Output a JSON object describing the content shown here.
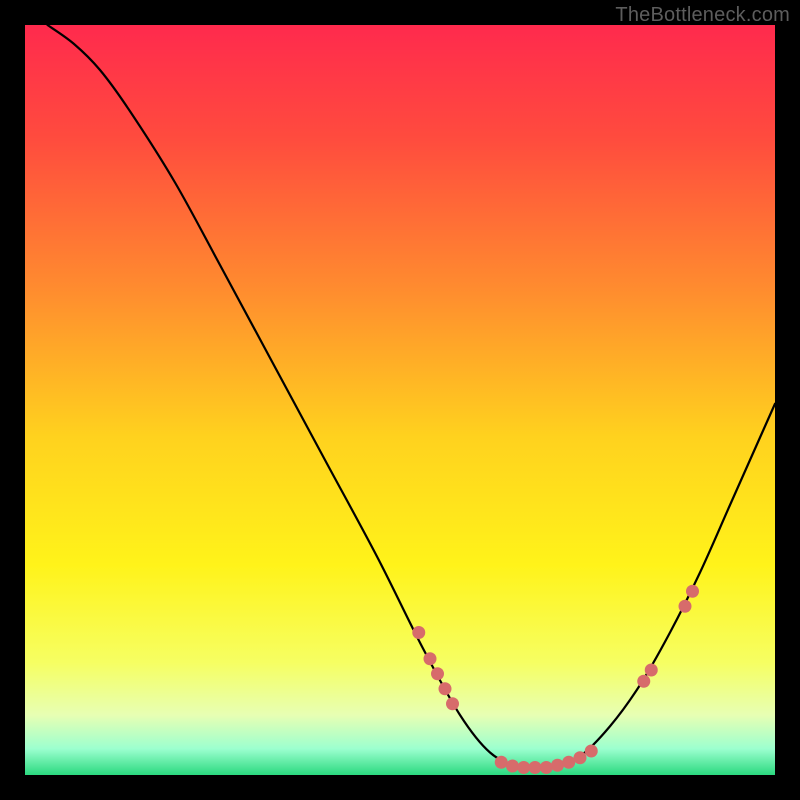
{
  "attribution": "TheBottleneck.com",
  "chart_data": {
    "type": "line",
    "title": "",
    "xlabel": "",
    "ylabel": "",
    "xlim": [
      0,
      100
    ],
    "ylim": [
      0,
      100
    ],
    "gradient_stops": [
      {
        "pos": 0.0,
        "color": "#ff2a4d"
      },
      {
        "pos": 0.15,
        "color": "#ff4b3e"
      },
      {
        "pos": 0.35,
        "color": "#ff8b2f"
      },
      {
        "pos": 0.55,
        "color": "#ffd21e"
      },
      {
        "pos": 0.72,
        "color": "#fff31a"
      },
      {
        "pos": 0.85,
        "color": "#f6ff62"
      },
      {
        "pos": 0.92,
        "color": "#e7ffb3"
      },
      {
        "pos": 0.965,
        "color": "#9cffcf"
      },
      {
        "pos": 1.0,
        "color": "#2bd97f"
      }
    ],
    "series": [
      {
        "name": "bottleneck-curve",
        "points": [
          {
            "x": 3.0,
            "y": 100.0
          },
          {
            "x": 6.5,
            "y": 97.5
          },
          {
            "x": 10.0,
            "y": 94.0
          },
          {
            "x": 14.0,
            "y": 88.5
          },
          {
            "x": 20.0,
            "y": 79.0
          },
          {
            "x": 26.0,
            "y": 68.0
          },
          {
            "x": 33.0,
            "y": 55.0
          },
          {
            "x": 40.0,
            "y": 42.0
          },
          {
            "x": 47.0,
            "y": 29.0
          },
          {
            "x": 53.0,
            "y": 17.0
          },
          {
            "x": 58.0,
            "y": 8.0
          },
          {
            "x": 62.0,
            "y": 3.0
          },
          {
            "x": 66.0,
            "y": 1.0
          },
          {
            "x": 70.0,
            "y": 1.0
          },
          {
            "x": 74.0,
            "y": 2.5
          },
          {
            "x": 78.0,
            "y": 6.5
          },
          {
            "x": 82.0,
            "y": 12.0
          },
          {
            "x": 86.0,
            "y": 19.0
          },
          {
            "x": 90.0,
            "y": 27.0
          },
          {
            "x": 94.0,
            "y": 36.0
          },
          {
            "x": 98.0,
            "y": 45.0
          },
          {
            "x": 100.0,
            "y": 49.5
          }
        ]
      }
    ],
    "scatter": {
      "name": "marker-points",
      "color": "#d76b6b",
      "radius": 6.5,
      "points": [
        {
          "x": 52.5,
          "y": 19.0
        },
        {
          "x": 54.0,
          "y": 15.5
        },
        {
          "x": 55.0,
          "y": 13.5
        },
        {
          "x": 56.0,
          "y": 11.5
        },
        {
          "x": 57.0,
          "y": 9.5
        },
        {
          "x": 63.5,
          "y": 1.7
        },
        {
          "x": 65.0,
          "y": 1.2
        },
        {
          "x": 66.5,
          "y": 1.0
        },
        {
          "x": 68.0,
          "y": 1.0
        },
        {
          "x": 69.5,
          "y": 1.0
        },
        {
          "x": 71.0,
          "y": 1.3
        },
        {
          "x": 72.5,
          "y": 1.7
        },
        {
          "x": 74.0,
          "y": 2.3
        },
        {
          "x": 75.5,
          "y": 3.2
        },
        {
          "x": 82.5,
          "y": 12.5
        },
        {
          "x": 83.5,
          "y": 14.0
        },
        {
          "x": 88.0,
          "y": 22.5
        },
        {
          "x": 89.0,
          "y": 24.5
        }
      ]
    }
  }
}
